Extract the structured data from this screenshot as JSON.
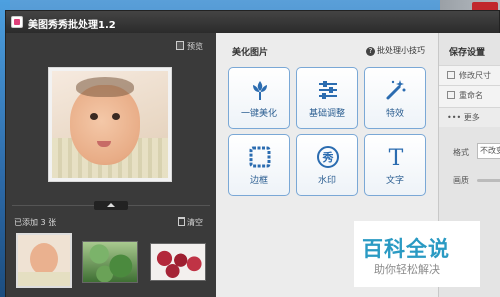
{
  "window": {
    "title": "美图秀秀批处理1.2"
  },
  "left_panel": {
    "preview_label": "预览",
    "added_count": "已添加 3 张",
    "clear_label": "清空"
  },
  "center_panel": {
    "section_title": "美化图片",
    "tips_label": "批处理小技巧",
    "tools": [
      {
        "label": "一键美化",
        "icon": "flower-icon"
      },
      {
        "label": "基础调整",
        "icon": "sliders-icon"
      },
      {
        "label": "特效",
        "icon": "magic-wand-icon"
      },
      {
        "label": "边框",
        "icon": "frame-icon"
      },
      {
        "label": "水印",
        "icon": "watermark-icon",
        "glyph": "秀"
      },
      {
        "label": "文字",
        "icon": "text-icon",
        "glyph": "T"
      }
    ]
  },
  "right_panel": {
    "title": "保存设置",
    "items": [
      {
        "label": "修改尺寸",
        "icon": "resize-icon"
      },
      {
        "label": "重命名",
        "icon": "rename-icon"
      }
    ],
    "more_label": "••• 更多",
    "format_label": "格式",
    "format_value": "不改变格式",
    "quality_label": "画质"
  },
  "watermark": {
    "logo": "百科全说",
    "subtitle": "助你轻松解决"
  },
  "colors": {
    "tool_border": "#7aa8d6",
    "tool_label": "#2b5e91",
    "titlebar": "#2b2b2b",
    "watermark_blue": "#2a9ac3"
  }
}
